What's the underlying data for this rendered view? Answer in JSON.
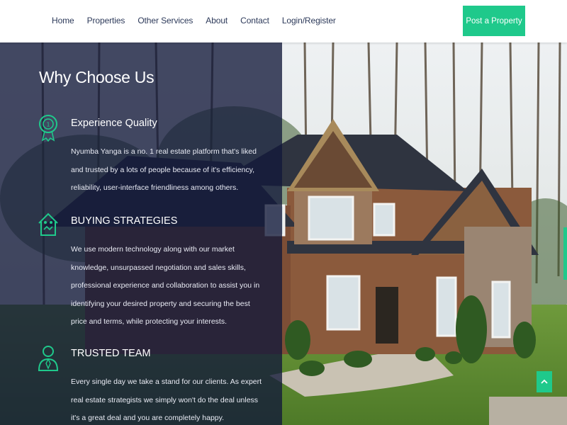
{
  "nav": {
    "links": [
      "Home",
      "Properties",
      "Other Services",
      "About",
      "Contact",
      "Login/Register"
    ],
    "cta": "Post a Property"
  },
  "section": {
    "title": "Why Choose Us",
    "features": [
      {
        "icon": "award-medal-icon",
        "title": "Experience Quality",
        "desc": "Nyumba Yanga is a no. 1 real estate platform that's liked and trusted by a lots of people because of it's efficiency, reliability, user-interface friendliness among others."
      },
      {
        "icon": "house-handshake-icon",
        "title": "BUYING STRATEGIES",
        "desc": "We use modern technology along with our market knowledge, unsurpassed negotiation and sales skills, professional experience and collaboration to assist you in identifying your desired property and securing the best price and terms, while protecting your interests."
      },
      {
        "icon": "user-team-icon",
        "title": "TRUSTED TEAM",
        "desc": "Every single day we take a stand for our clients. As expert real estate strategists we simply won't do the deal unless it's a great deal and you are completely happy."
      }
    ]
  },
  "scroll_top_icon": "chevron-up-icon",
  "colors": {
    "accent": "#1fc98b",
    "overlay": "#12183a",
    "nav_text": "#2d3a5a"
  }
}
